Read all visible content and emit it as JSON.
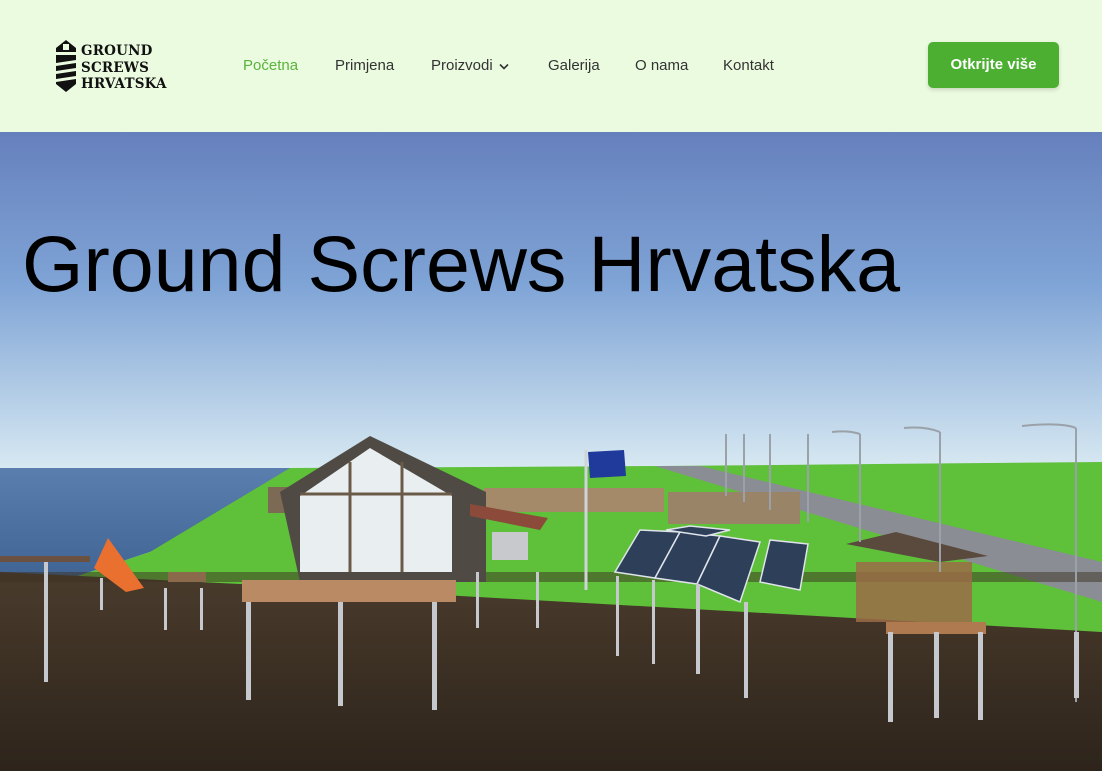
{
  "brand": {
    "name_lines": [
      "GROUND",
      "SCREWS",
      "HRVATSKA"
    ]
  },
  "nav": {
    "items": [
      {
        "label": "Početna",
        "active": true
      },
      {
        "label": "Primjena",
        "active": false
      },
      {
        "label": "Proizvodi",
        "active": false,
        "has_dropdown": true
      },
      {
        "label": "Galerija",
        "active": false
      },
      {
        "label": "O nama",
        "active": false
      },
      {
        "label": "Kontakt",
        "active": false
      }
    ]
  },
  "cta": {
    "label": "Otkrijte više"
  },
  "hero": {
    "title": "Ground Screws Hrvatska"
  },
  "colors": {
    "header_bg": "#ebfbe0",
    "accent_green": "#4caf32",
    "active_nav": "#59b33c"
  }
}
